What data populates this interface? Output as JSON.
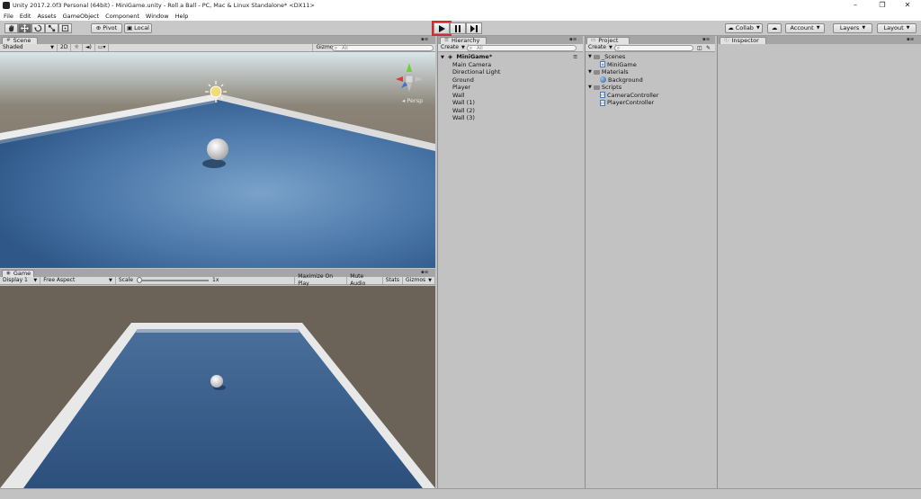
{
  "window": {
    "title": "Unity 2017.2.0f3 Personal (64bit) - MiniGame.unity - Roll a Ball - PC, Mac & Linux Standalone* <DX11>",
    "controls": {
      "minimize": "–",
      "restore": "❐",
      "close": "✕"
    }
  },
  "menu": [
    "File",
    "Edit",
    "Assets",
    "GameObject",
    "Component",
    "Window",
    "Help"
  ],
  "toolbar": {
    "pivot_label": "Pivot",
    "local_label": "Local",
    "collab_label": "Collab",
    "account_label": "Account",
    "layers_label": "Layers",
    "layout_label": "Layout"
  },
  "scene": {
    "tab_label": "Scene",
    "shading": "Shaded",
    "mode_2d": "2D",
    "gizmos": "Gizmos",
    "search_placeholder": "All",
    "persp_label": "Persp"
  },
  "game": {
    "tab_label": "Game",
    "display": "Display 1",
    "aspect": "Free Aspect",
    "scale_label": "Scale",
    "scale_value": "1x",
    "maximize_label": "Maximize On Play",
    "mute_label": "Mute Audio",
    "stats_label": "Stats",
    "gizmos_label": "Gizmos"
  },
  "hierarchy": {
    "tab_label": "Hierarchy",
    "create_label": "Create",
    "search_placeholder": "All",
    "root": "MiniGame*",
    "items": [
      "Main Camera",
      "Directional Light",
      "Ground",
      "Player",
      "Wall",
      "Wall (1)",
      "Wall (2)",
      "Wall (3)"
    ]
  },
  "project": {
    "tab_label": "Project",
    "create_label": "Create",
    "folders": [
      {
        "name": "_Scenes",
        "children": [
          "MiniGame"
        ]
      },
      {
        "name": "Materials",
        "children": [
          "Background"
        ]
      },
      {
        "name": "Scripts",
        "children": [
          "CameraController",
          "PlayerController"
        ]
      }
    ]
  },
  "inspector": {
    "tab_label": "Inspector"
  },
  "colors": {
    "highlight": "#d42a2a",
    "floor": "#3d6597",
    "wall": "#e6e6e6",
    "backdrop": "#6b6258"
  }
}
